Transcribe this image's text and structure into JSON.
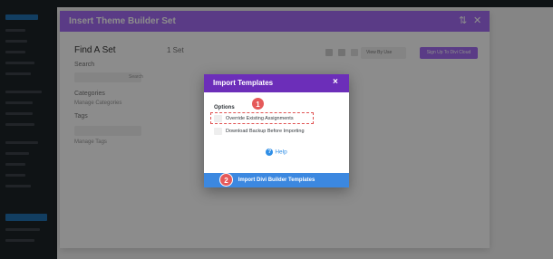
{
  "wp": {
    "topbar_label": "Dashboard",
    "sidebar_items": [
      "Posts",
      "Media",
      "Pages",
      "Comments",
      "Projects",
      "WooCommerce",
      "Products",
      "Analytics",
      "Marketing",
      "Appearance",
      "Plugins",
      "Users",
      "Tools",
      "Settings",
      "Divi",
      "Theme Builder",
      "Theme Options"
    ]
  },
  "theme_builder": {
    "title": "Insert Theme Builder Set",
    "side_title": "Find A Set",
    "search_label": "Search",
    "search_button": "Search",
    "categories_label": "Categories",
    "categories_value": "Manage Categories",
    "tags_label": "Tags",
    "tags_value": "Manage Tags",
    "count": "1 Set",
    "select_value": "View By Use",
    "upload_button": "Sign Up To Divi Cloud"
  },
  "import_modal": {
    "title": "Import Templates",
    "close": "×",
    "options_title": "Options",
    "option_override": "Override Existing Assignments",
    "option_backup": "Download Backup Before Importing",
    "help_label": "Help",
    "help_icon": "?",
    "import_button": "Import Divi Builder Templates"
  },
  "badges": {
    "one": "1",
    "two": "2"
  },
  "colors": {
    "theme_builder_header": "#a46cf5",
    "import_header": "#6c2eb9",
    "import_button": "#3c88e0",
    "badge": "#e55a5a"
  }
}
